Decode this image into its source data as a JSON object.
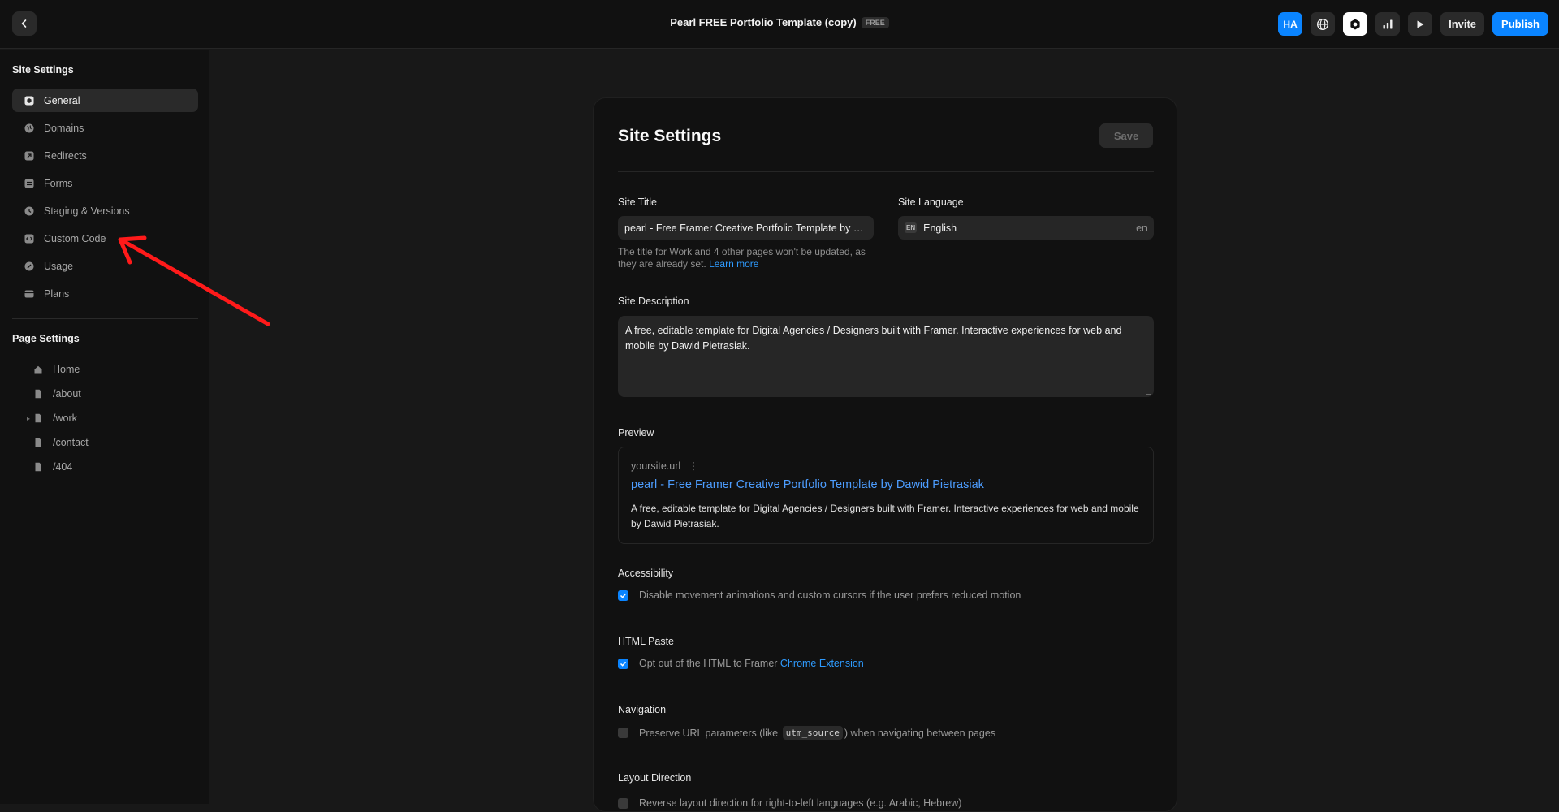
{
  "topbar": {
    "title": "Pearl FREE Portfolio Template (copy)",
    "badge": "FREE",
    "avatar": "HA",
    "invite": "Invite",
    "publish": "Publish",
    "icons": [
      "globe-icon",
      "settings-hex-icon",
      "analytics-bars-icon",
      "play-icon"
    ]
  },
  "sidebar": {
    "site_heading": "Site Settings",
    "items": [
      {
        "label": "General",
        "icon": "general-icon",
        "active": true
      },
      {
        "label": "Domains",
        "icon": "globe-icon"
      },
      {
        "label": "Redirects",
        "icon": "redirect-icon"
      },
      {
        "label": "Forms",
        "icon": "forms-icon"
      },
      {
        "label": "Staging & Versions",
        "icon": "clock-icon"
      },
      {
        "label": "Custom Code",
        "icon": "code-icon"
      },
      {
        "label": "Usage",
        "icon": "gauge-icon"
      },
      {
        "label": "Plans",
        "icon": "card-icon"
      }
    ],
    "page_heading": "Page Settings",
    "pages": [
      {
        "label": "Home",
        "icon": "home-icon"
      },
      {
        "label": "/about",
        "icon": "page-icon"
      },
      {
        "label": "/work",
        "icon": "page-icon",
        "expandable": true
      },
      {
        "label": "/contact",
        "icon": "page-icon"
      },
      {
        "label": "/404",
        "icon": "page-icon"
      }
    ]
  },
  "panel": {
    "title": "Site Settings",
    "save": "Save",
    "site_title_label": "Site Title",
    "site_title_value": "pearl - Free Framer Creative Portfolio Template by Dawid Pietrasiak",
    "site_title_hint": "The title for Work and 4 other pages won't be updated, as they are already set.",
    "learn_more": "Learn more",
    "language_label": "Site Language",
    "language_badge": "EN",
    "language_value": "English",
    "language_code": "en",
    "description_label": "Site Description",
    "description_value": "A free, editable template for Digital Agencies / Designers built with Framer. Interactive experiences for web and mobile by Dawid Pietrasiak.",
    "preview_label": "Preview",
    "preview_url": "yoursite.url",
    "preview_title": "pearl - Free Framer Creative Portfolio Template by Dawid Pietrasiak",
    "preview_desc": "A free, editable template for Digital Agencies / Designers built with Framer. Interactive experiences for web and mobile by Dawid Pietrasiak.",
    "accessibility_label": "Accessibility",
    "accessibility_text": "Disable movement animations and custom cursors if the user prefers reduced motion",
    "accessibility_checked": true,
    "html_paste_label": "HTML Paste",
    "html_paste_text": "Opt out of the HTML to Framer",
    "html_paste_link": "Chrome Extension",
    "html_paste_checked": true,
    "navigation_label": "Navigation",
    "navigation_text_before": "Preserve URL parameters (like",
    "navigation_code": "utm_source",
    "navigation_text_after": ") when navigating between pages",
    "navigation_checked": false,
    "layout_label": "Layout Direction",
    "layout_text": "Reverse layout direction for right-to-left languages (e.g. Arabic, Hebrew)",
    "layout_checked": false
  },
  "colors": {
    "accent": "#0a84ff",
    "annotation_arrow": "#ff1a1a"
  }
}
